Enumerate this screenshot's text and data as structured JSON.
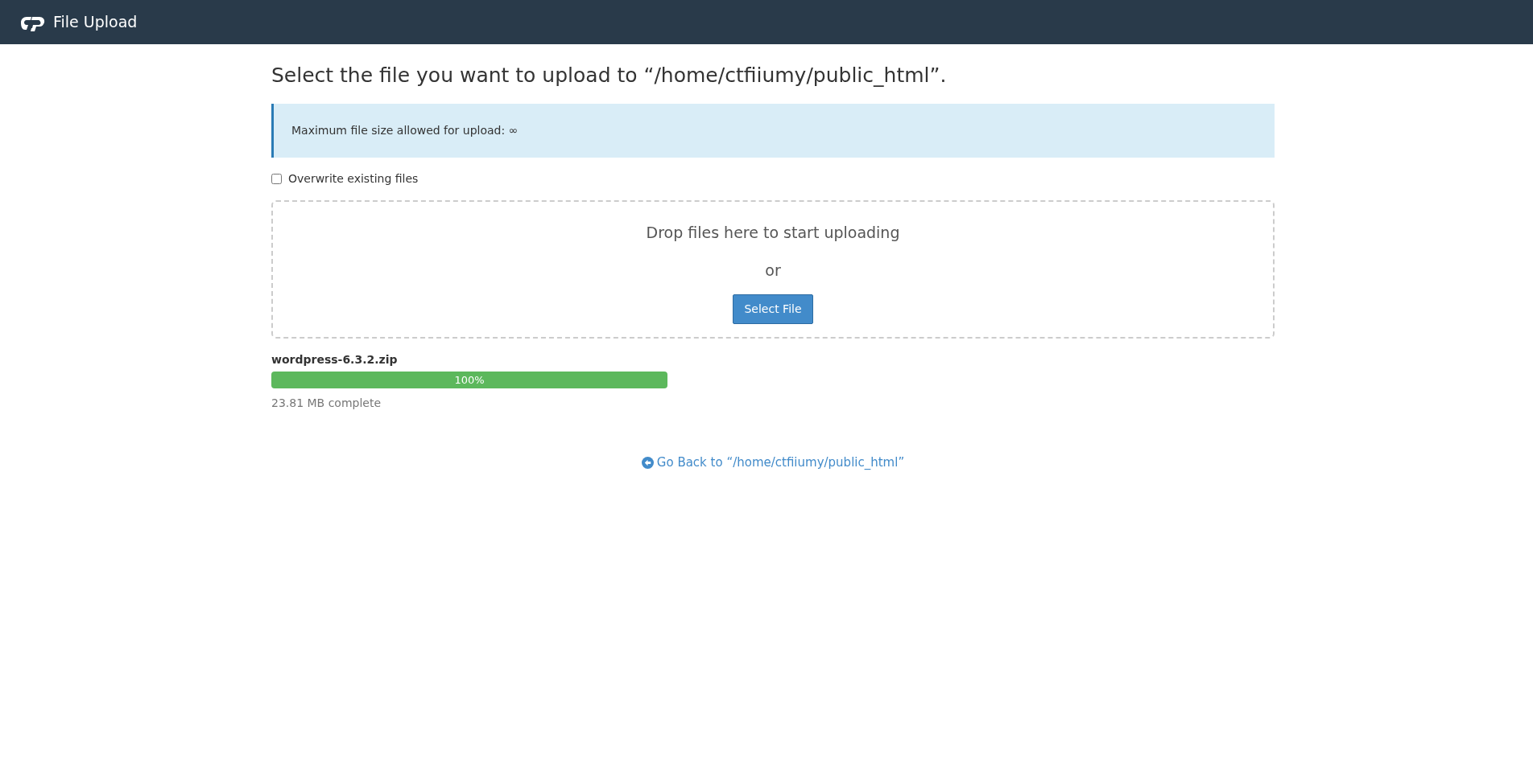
{
  "header": {
    "title": "File Upload"
  },
  "heading": "Select the file you want to upload to “/home/ctfiiumy/public_html”.",
  "alert": "Maximum file size allowed for upload: ∞",
  "overwrite": {
    "label": "Overwrite existing files",
    "checked": false
  },
  "dropzone": {
    "prompt": "Drop files here to start uploading",
    "separator": "or",
    "button": "Select File"
  },
  "uploads": [
    {
      "name": "wordpress-6.3.2.zip",
      "level": 1,
      "reading": "100%",
      "status": "23.81 MB complete"
    }
  ],
  "back_link": "Go Back to “/home/ctfiiumy/public_html”"
}
